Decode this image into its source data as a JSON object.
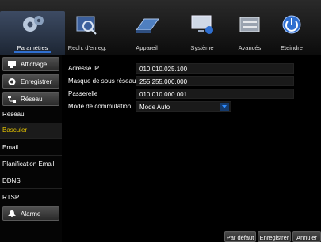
{
  "tabs": [
    {
      "label": "Paramètres",
      "icon": "gear-icon"
    },
    {
      "label": "Rech. d'enreg.",
      "icon": "search-playback-icon"
    },
    {
      "label": "Appareil",
      "icon": "hard-drive-icon"
    },
    {
      "label": "Système",
      "icon": "monitor-info-icon"
    },
    {
      "label": "Avancés",
      "icon": "advanced-settings-icon"
    },
    {
      "label": "Eteindre",
      "icon": "power-icon"
    }
  ],
  "sidebar": {
    "affichage": "Affichage",
    "enregistrer": "Enregistrer",
    "reseau": "Réseau",
    "items": [
      "Réseau",
      "Basculer",
      "Email",
      "Planification Email",
      "DDNS",
      "RTSP"
    ],
    "active_item": "Basculer",
    "alarme": "Alarme"
  },
  "form": {
    "ip_label": "Adresse IP",
    "ip_value": "010.010.025.100",
    "mask_label": "Masque de sous réseau",
    "mask_value": "255.255.000.000",
    "gw_label": "Passerelle",
    "gw_value": "010.010.000.001",
    "mode_label": "Mode de commutation",
    "mode_value": "Mode Auto"
  },
  "buttons": {
    "default": "Par défaut",
    "save": "Enregistrer",
    "cancel": "Annuler"
  },
  "colors": {
    "accent": "#2f6fd0",
    "active_text": "#e6c400"
  }
}
